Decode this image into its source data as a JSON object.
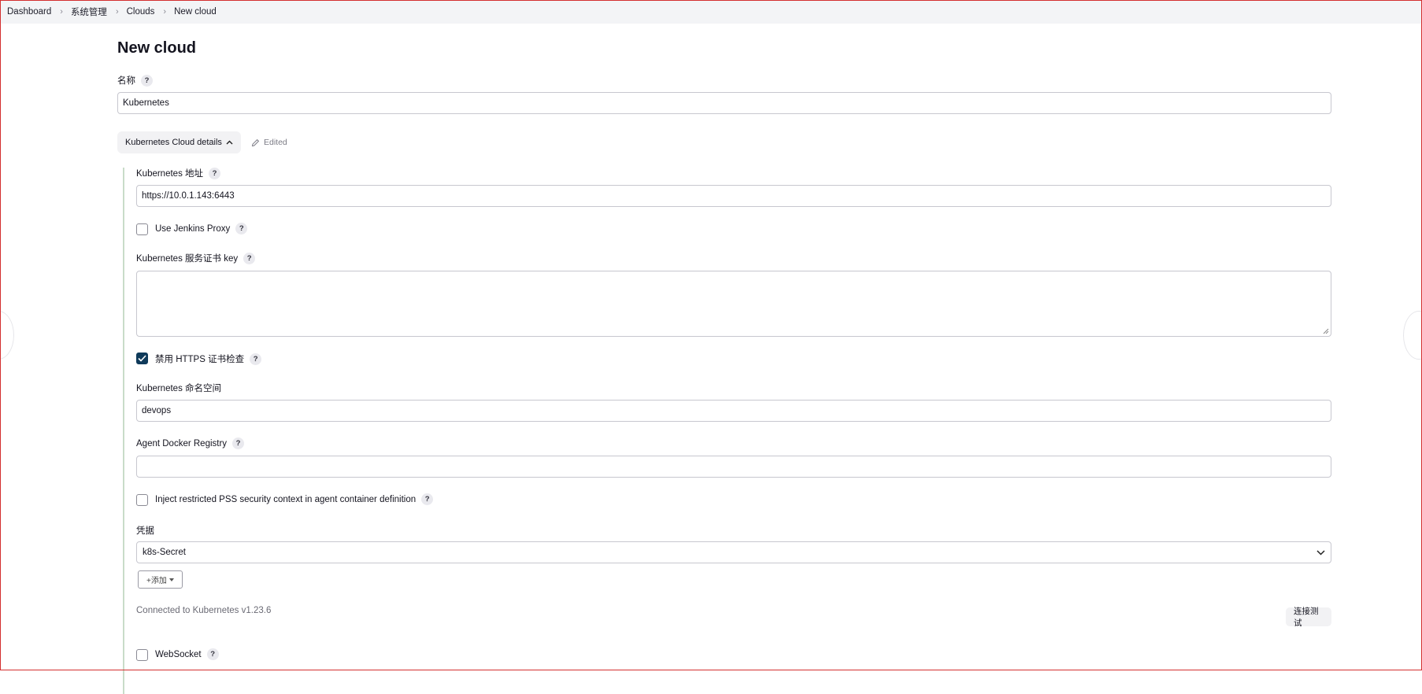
{
  "breadcrumb": {
    "items": [
      "Dashboard",
      "系统管理",
      "Clouds",
      "New cloud"
    ]
  },
  "page": {
    "title": "New cloud"
  },
  "name_field": {
    "label": "名称",
    "value": "Kubernetes"
  },
  "section": {
    "toggle_label": "Kubernetes Cloud details",
    "edited_label": "Edited"
  },
  "k8s_url": {
    "label": "Kubernetes 地址",
    "value": "https://10.0.1.143:6443"
  },
  "jenkins_proxy": {
    "label": "Use Jenkins Proxy",
    "checked": false
  },
  "server_cert_key": {
    "label": "Kubernetes 服务证书 key",
    "value": ""
  },
  "disable_https_check": {
    "label": "禁用 HTTPS 证书检查",
    "checked": true
  },
  "namespace": {
    "label": "Kubernetes 命名空间",
    "value": "devops"
  },
  "docker_registry": {
    "label": "Agent Docker Registry",
    "value": ""
  },
  "inject_pss": {
    "label": "Inject restricted PSS security context in agent container definition",
    "checked": false
  },
  "credentials": {
    "label": "凭据",
    "selected": "k8s-Secret",
    "add_button": "+添加"
  },
  "connection": {
    "status": "Connected to Kubernetes v1.23.6",
    "test_button": "连接测试"
  },
  "websocket": {
    "label": "WebSocket",
    "checked": false
  },
  "colors": {
    "checkbox_checked": "#0f3a5a",
    "section_bar": "#c9dcc9",
    "frame_border": "#d32f2f"
  }
}
